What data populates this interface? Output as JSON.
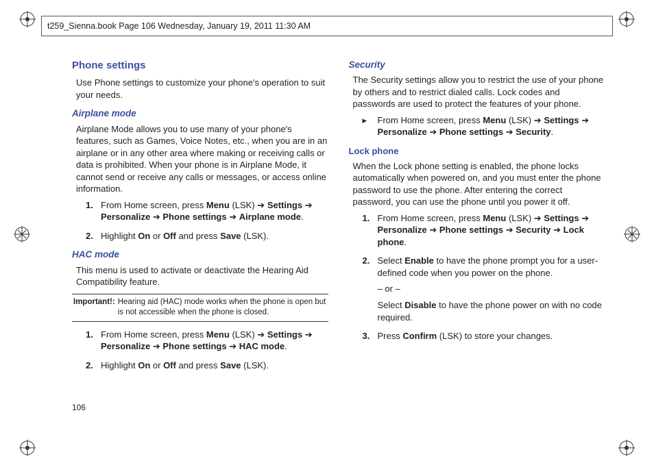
{
  "header": "t259_Sienna.book  Page 106  Wednesday, January 19, 2011  11:30 AM",
  "pageNumber": "106",
  "col1": {
    "phoneSettings": {
      "title": "Phone settings",
      "intro": "Use Phone settings to customize your phone's operation to suit your needs."
    },
    "airplane": {
      "title": "Airplane mode",
      "body": "Airplane Mode allows you to use many of your phone's features, such as Games, Voice Notes, etc., when you are in an airplane or in any other area where making or receiving calls or data is prohibited. When your phone is in Airplane Mode, it cannot send or receive any calls or messages, or access online information.",
      "step1_pre": "From Home screen, press ",
      "step1_menu": "Menu",
      "step1_lsk": " (LSK) ",
      "step1_settings": "Settings",
      "step1_personalize": "Personalize",
      "step1_phonesettings": "Phone settings",
      "step1_airplane": "Airplane mode",
      "step2_pre": "Highlight ",
      "step2_on": "On",
      "step2_or": " or ",
      "step2_off": "Off",
      "step2_and": " and press ",
      "step2_save": "Save",
      "step2_post": " (LSK)."
    },
    "hac": {
      "title": "HAC mode",
      "body": "This menu is used to activate or deactivate the Hearing Aid Compatibility feature.",
      "importantLabel": "Important!:",
      "importantText": "Hearing aid (HAC) mode works when the phone is open but is not accessible when the phone is closed.",
      "step1_hac": "HAC mode"
    }
  },
  "col2": {
    "security": {
      "title": "Security",
      "body": "The Security settings allow you to restrict the use of your phone by others and to restrict dialed calls. Lock codes and passwords are used to protect the features of your phone.",
      "step_security": "Security"
    },
    "lock": {
      "title": "Lock phone",
      "body": "When the Lock phone setting is enabled, the phone locks automatically when powered on, and you must enter the phone password to use the phone. After entering the correct password, you can use the phone until you power it off.",
      "step1_security": "Security",
      "step1_lock": "Lock phone",
      "step2_pre": "Select ",
      "step2_enable": "Enable",
      "step2_mid": " to have the phone prompt you for a user-defined code when you power on the phone.",
      "step2_or": "– or –",
      "step2_disable": "Disable",
      "step2_post": " to have the phone power on with no code required.",
      "step3_pre": "Press ",
      "step3_confirm": "Confirm",
      "step3_post": " (LSK) to store your changes."
    }
  },
  "arrow": " ➔ "
}
